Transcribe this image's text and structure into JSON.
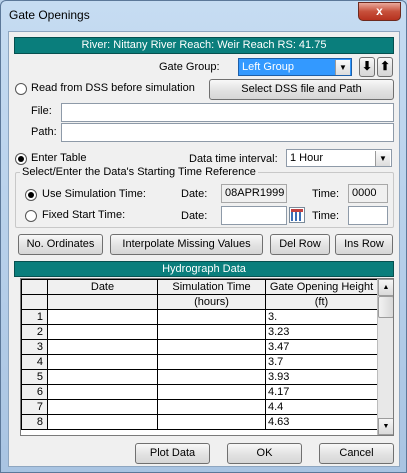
{
  "window": {
    "title": "Gate Openings",
    "close_glyph": "x"
  },
  "header": {
    "location": "River: Nittany River  Reach: Weir Reach  RS: 41.75"
  },
  "gate_group": {
    "label": "Gate Group:",
    "value": "Left Group"
  },
  "dss": {
    "radio_label": "Read from DSS before simulation",
    "select_button": "Select DSS file and Path",
    "file_label": "File:",
    "file_value": "",
    "path_label": "Path:",
    "path_value": ""
  },
  "enter_table": {
    "radio_label": "Enter Table",
    "interval_label": "Data time interval:",
    "interval_value": "1 Hour"
  },
  "time_ref": {
    "legend": "Select/Enter the Data's Starting Time Reference",
    "use_sim_label": "Use Simulation Time:",
    "date_label": "Date:",
    "sim_date": "08APR1999",
    "time_label": "Time:",
    "sim_time": "0000",
    "fixed_label": "Fixed Start Time:",
    "fixed_date": "",
    "fixed_time": ""
  },
  "buttons": {
    "no_ordinates": "No. Ordinates",
    "interpolate": "Interpolate Missing Values",
    "del_row": "Del Row",
    "ins_row": "Ins Row",
    "plot": "Plot Data",
    "ok": "OK",
    "cancel": "Cancel"
  },
  "hydrograph": {
    "title": "Hydrograph Data",
    "columns": [
      {
        "header": "Date",
        "unit": ""
      },
      {
        "header": "Simulation Time",
        "unit": "(hours)"
      },
      {
        "header": "Gate Opening Height",
        "unit": "(ft)"
      }
    ],
    "rows": [
      {
        "n": "1",
        "date": "",
        "time": "",
        "height": "3."
      },
      {
        "n": "2",
        "date": "",
        "time": "",
        "height": "3.23"
      },
      {
        "n": "3",
        "date": "",
        "time": "",
        "height": "3.47"
      },
      {
        "n": "4",
        "date": "",
        "time": "",
        "height": "3.7"
      },
      {
        "n": "5",
        "date": "",
        "time": "",
        "height": "3.93"
      },
      {
        "n": "6",
        "date": "",
        "time": "",
        "height": "4.17"
      },
      {
        "n": "7",
        "date": "",
        "time": "",
        "height": "4.4"
      },
      {
        "n": "8",
        "date": "",
        "time": "",
        "height": "4.63"
      }
    ]
  },
  "icons": {
    "move_down": "down-arrow-icon",
    "move_up": "up-arrow-icon",
    "calendar": "calendar-icon",
    "dropdown": "chevron-down-icon"
  }
}
